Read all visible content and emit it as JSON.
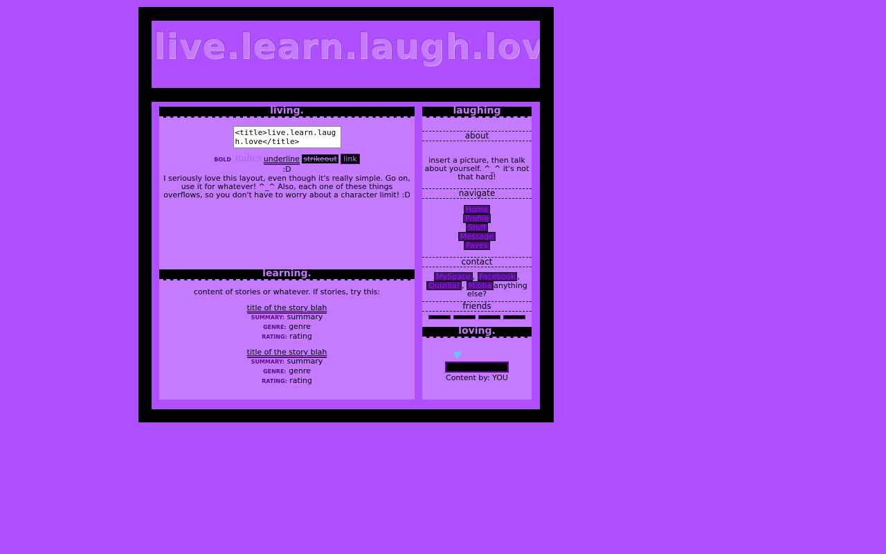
{
  "header": {
    "title": "live.learn.laugh.love."
  },
  "living": {
    "heading": "living.",
    "code_textarea": "<title>live.learn.laugh.love</title>",
    "format": {
      "bold": "BOLD",
      "italics": "italics",
      "underline": "underline",
      "strikeout": "strikeout",
      "link": "link",
      "smile": ":D"
    },
    "body": "I seriously love this layout, even though it's really simple. Go on, use it for whatever! ^_^ Also, each one of these things overflows, so you don't have to worry about a character limit! :D"
  },
  "learning": {
    "heading": "learning.",
    "intro": "content of stories or whatever. if stories, try this:",
    "stories": [
      {
        "title": "title of the story blah",
        "summary_label": "SUMMARY:",
        "summary": "summary",
        "genre_label": "GENRE:",
        "genre": "genre",
        "rating_label": "RATING:",
        "rating": "rating"
      },
      {
        "title": "title of the story blah",
        "summary_label": "SUMMARY:",
        "summary": "summary",
        "genre_label": "GENRE:",
        "genre": "genre",
        "rating_label": "RATING:",
        "rating": "rating"
      }
    ]
  },
  "laughing": {
    "heading": "laughing",
    "about_heading": "about",
    "about_text": "insert a picture, then talk about yourself. ^_^ it's not that hard!",
    "navigate_heading": "navigate",
    "nav_links": [
      "Home",
      "Profile",
      "Stuff",
      "Message",
      "Faves"
    ],
    "contact_heading": "contact",
    "contact_links": [
      "MySpace",
      "Facebook",
      "Quizilla!",
      "Mibba"
    ],
    "contact_tail": "anything else?",
    "friends_heading": "friends"
  },
  "loving": {
    "heading": "loving.",
    "credit": "Content by: YOU"
  },
  "colors": {
    "page_bg": "#b04fff",
    "panel_bg": "#c47bff",
    "frame": "#000000",
    "accent_dark": "#5a0a8a",
    "heart": "#6ec3ff"
  }
}
